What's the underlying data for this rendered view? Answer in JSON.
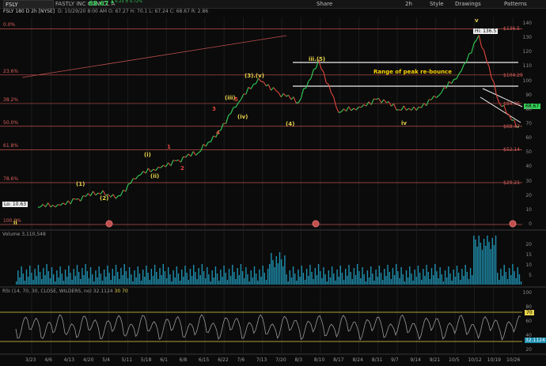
{
  "topbar": {
    "symbol": "FSLY",
    "company": "FASTLY INC COM CL A",
    "last": "68.67",
    "change": "▲ 0.23 ± 0.72%",
    "buttons": [
      "Share",
      "2h",
      "Style",
      "Drawings",
      "Patterns"
    ]
  },
  "info": {
    "chart_title": "FSLY 180 D 2h [NYSE]",
    "ohlc": "D: 10/29/20 8:00 AM  O: 67.27  H: 70.1  L: 67.24  C: 68.67  R: 2.86"
  },
  "fib_levels": [
    {
      "pct": "0.0%",
      "price": "$136.5",
      "value": 136.5
    },
    {
      "pct": "23.6%",
      "price": "$104.29",
      "value": 104.29
    },
    {
      "pct": "38.2%",
      "price": "$84.36",
      "value": 84.36
    },
    {
      "pct": "50.0%",
      "price": "$68.47",
      "value": 68.47
    },
    {
      "pct": "61.8%",
      "price": "$52.14",
      "value": 52.14
    },
    {
      "pct": "78.6%",
      "price": "$29.21",
      "value": 29.21
    },
    {
      "pct": "100.0%",
      "price": "",
      "value": 0
    }
  ],
  "annotations": {
    "hi": "Hi: 136.5",
    "lo": "Lo: 10.63",
    "range": "Range of peak re-bounce",
    "last_price_badge": "68.67",
    "waves_yellow": [
      "(1)",
      "(2)",
      "(i)",
      "(ii)",
      "(iii)",
      "(iv)",
      "(3).(v)",
      "(4)",
      "iii.(5)",
      "iv",
      "v",
      "ii"
    ],
    "waves_red": [
      "1",
      "2",
      "3",
      "4",
      "5"
    ]
  },
  "volume": {
    "label": "Volume",
    "value": "3,110,548",
    "axis": [
      "20",
      "15",
      "10",
      "5"
    ]
  },
  "rsi": {
    "label": "RSI (14, 70, 30, CLOSE, WILDERS, no)",
    "value": "32.1124",
    "ob": "30",
    "os": "70",
    "value_badge": "32.1124",
    "axis": [
      "100",
      "80",
      "60",
      "40",
      "20"
    ],
    "ob_badge": "70"
  },
  "xaxis": [
    "3/23",
    "4/6",
    "4/13",
    "4/20",
    "5/4",
    "5/11",
    "5/18",
    "6/1",
    "6/8",
    "6/15",
    "6/22",
    "7/6",
    "7/13",
    "7/20",
    "8/3",
    "8/10",
    "8/17",
    "8/24",
    "8/31",
    "9/7",
    "9/14",
    "9/21",
    "10/5",
    "10/12",
    "10/19",
    "10/26"
  ],
  "price_axis": [
    "140",
    "130",
    "120",
    "110",
    "100",
    "90",
    "80",
    "70",
    "60",
    "50",
    "40",
    "30",
    "20",
    "10",
    "0"
  ],
  "colors": {
    "up": "#34d058",
    "down": "#e0473c",
    "fib": "#c0504d",
    "wave": "#e6d24a",
    "volume": "#1e90b0",
    "rsi": "#9a9a9a"
  },
  "chart_data": {
    "type": "line",
    "title": "FSLY 180 D 2h [NYSE]",
    "x": [
      "3/23",
      "4/6",
      "4/13",
      "4/20",
      "5/4",
      "5/11",
      "5/18",
      "6/1",
      "6/8",
      "6/15",
      "6/22",
      "7/6",
      "7/13",
      "7/20",
      "8/3",
      "8/10",
      "8/17",
      "8/24",
      "8/31",
      "9/14",
      "9/21",
      "10/5",
      "10/12",
      "10/19",
      "10/26"
    ],
    "series": [
      {
        "name": "FSLY",
        "values": [
          12,
          14,
          18,
          22,
          20,
          34,
          40,
          45,
          50,
          65,
          85,
          102,
          92,
          85,
          115,
          78,
          82,
          88,
          80,
          82,
          90,
          105,
          132,
          85,
          68
        ]
      }
    ],
    "ylim": [
      0,
      140
    ]
  }
}
